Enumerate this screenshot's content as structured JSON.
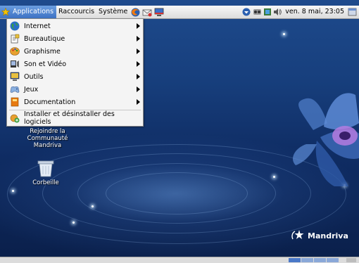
{
  "topbar": {
    "applications_label": "Applications",
    "raccourcis_label": "Raccourcis",
    "systeme_label": "Système",
    "clock": "ven. 8 mai, 23:05"
  },
  "menu": {
    "items": [
      {
        "label": "Internet",
        "icon": "globe-icon",
        "submenu": true
      },
      {
        "label": "Bureautique",
        "icon": "office-icon",
        "submenu": true
      },
      {
        "label": "Graphisme",
        "icon": "palette-icon",
        "submenu": true
      },
      {
        "label": "Son et Vidéo",
        "icon": "multimedia-icon",
        "submenu": true
      },
      {
        "label": "Outils",
        "icon": "tools-icon",
        "submenu": true
      },
      {
        "label": "Jeux",
        "icon": "gamepad-icon",
        "submenu": true
      },
      {
        "label": "Documentation",
        "icon": "book-icon",
        "submenu": true
      },
      {
        "label": "Installer et désinstaller des logiciels",
        "icon": "install-icon",
        "submenu": false
      }
    ]
  },
  "desktop": {
    "community_label_line1": "Rejoindre la",
    "community_label_line2": "Communauté",
    "community_label_line3": "Mandriva",
    "trash_label": "Corbeille",
    "brand": "Mandriva"
  },
  "colors": {
    "accent": "#3d72c4",
    "panel": "#e6e6e6"
  }
}
